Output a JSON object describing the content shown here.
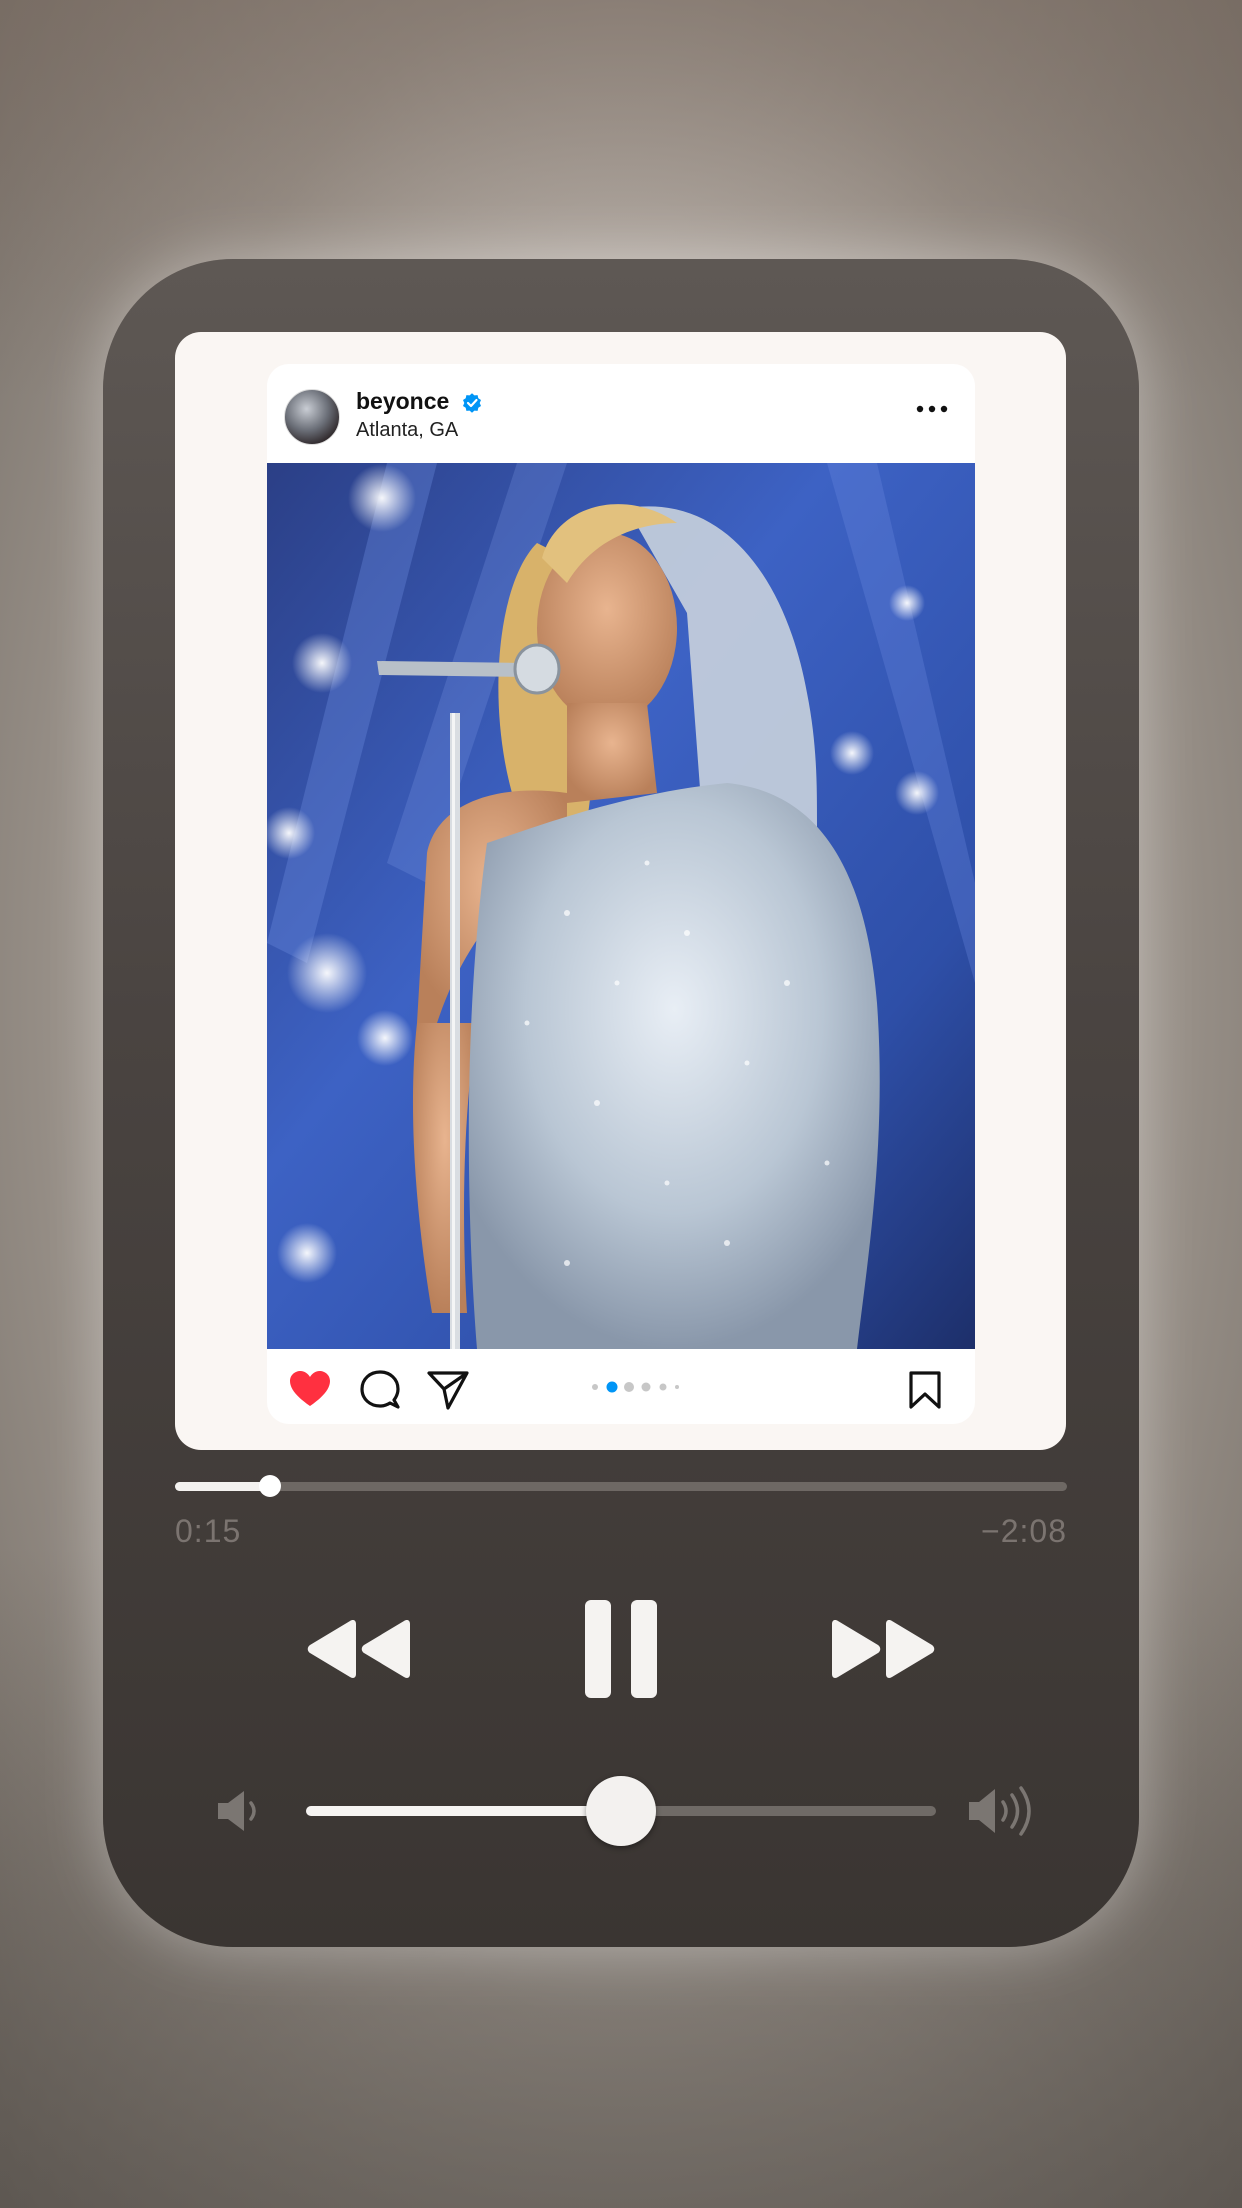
{
  "post": {
    "username": "beyonce",
    "verified": true,
    "location": "Atlanta, GA",
    "liked": true,
    "carousel_dots": 5,
    "carousel_active_index": 1
  },
  "player": {
    "elapsed": "0:15",
    "remaining": "−2:08",
    "progress_fraction": 0.107,
    "volume_fraction": 0.5,
    "state": "playing"
  },
  "colors": {
    "like_red": "#ff3040",
    "verified_blue": "#0095f6",
    "carousel_active": "#0095f6"
  },
  "icons": {
    "like": "heart-icon",
    "comment": "comment-icon",
    "share": "send-icon",
    "save": "bookmark-icon",
    "more": "more-horizontal-icon",
    "rewind": "rewind-icon",
    "pause": "pause-icon",
    "forward": "fast-forward-icon",
    "volume_low": "volume-low-icon",
    "volume_high": "volume-high-icon"
  }
}
